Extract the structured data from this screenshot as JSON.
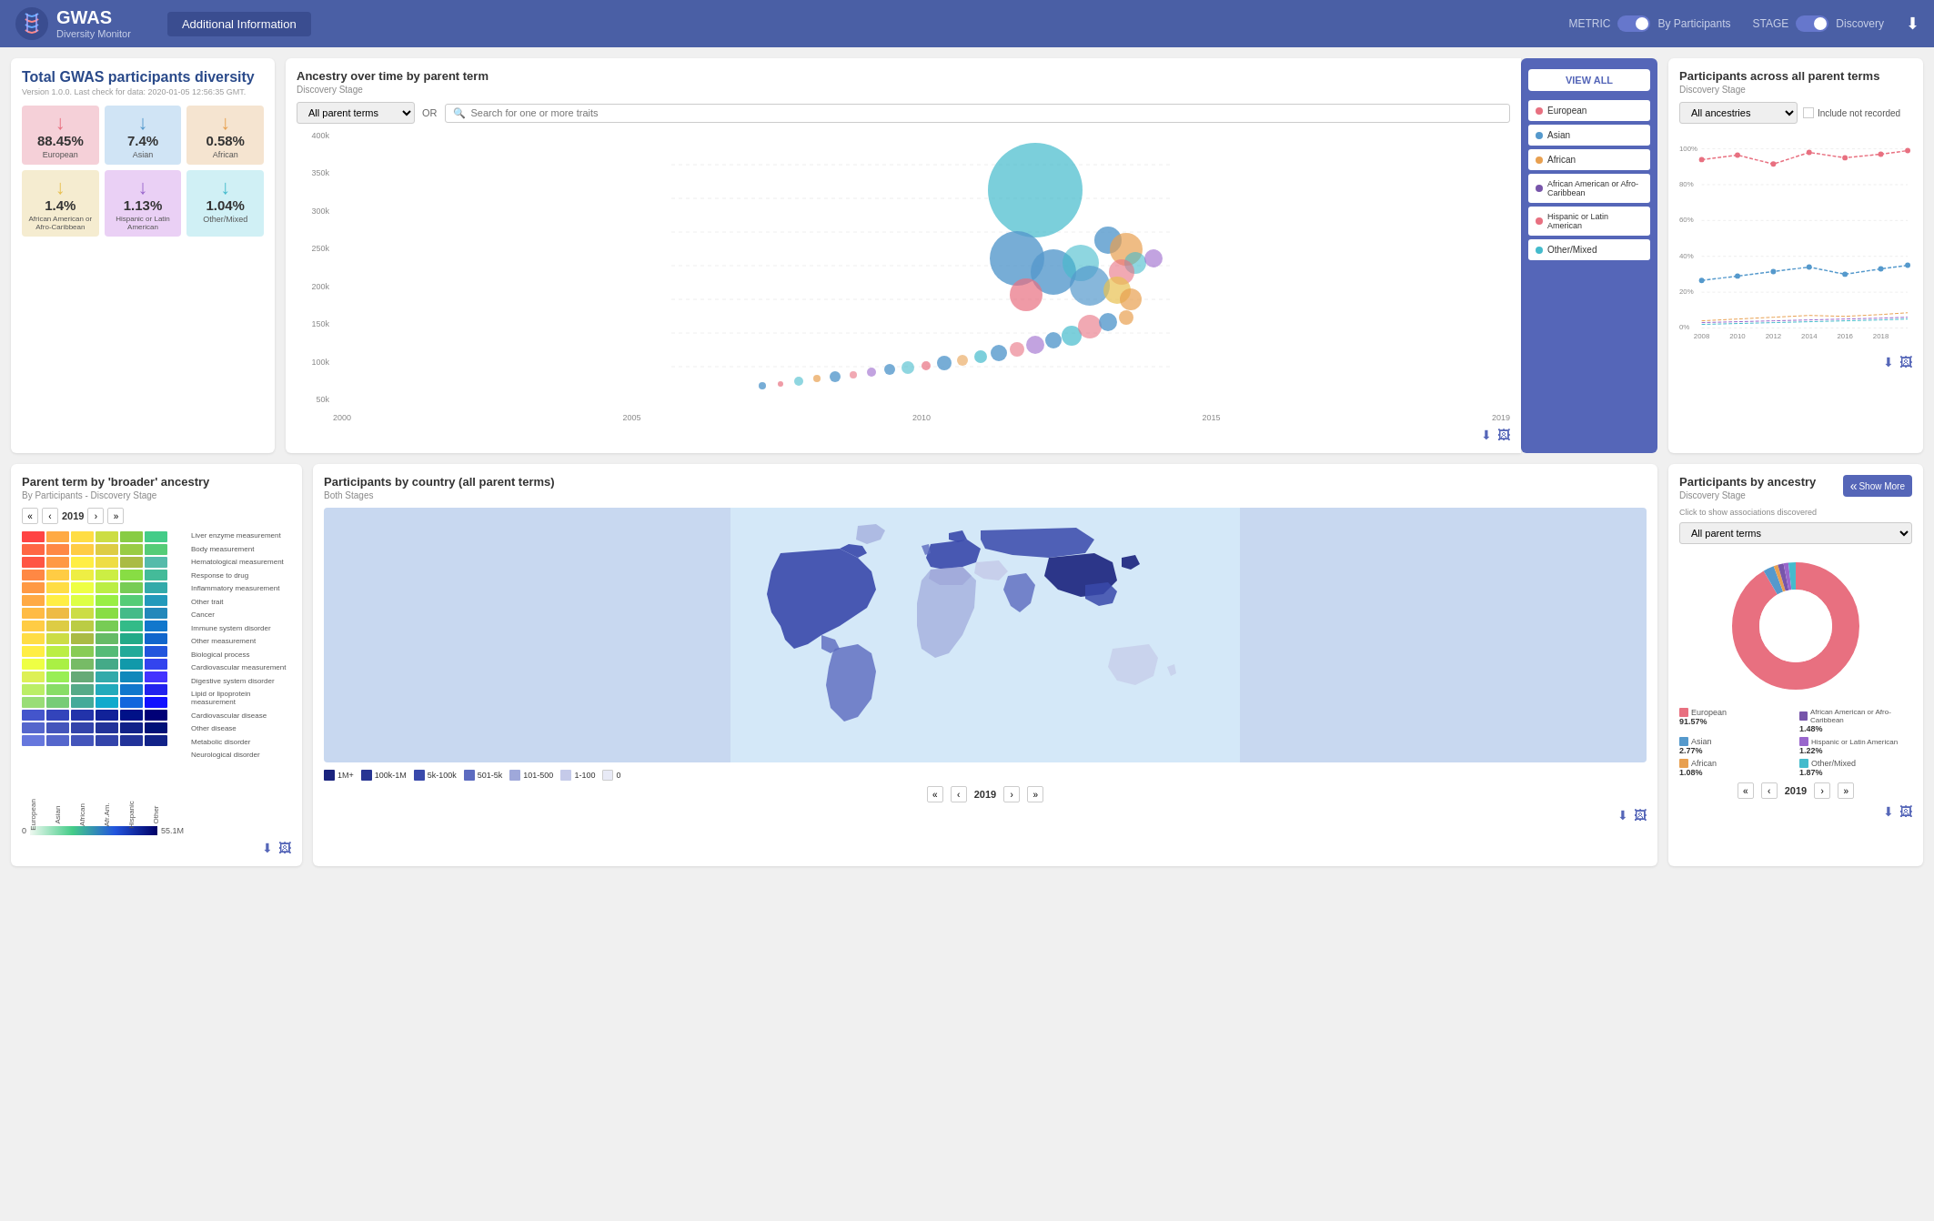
{
  "header": {
    "logo_title": "GWAS",
    "logo_subtitle": "Diversity Monitor",
    "nav_button": "Additional Information",
    "metric_label": "METRIC",
    "metric_value": "By Participants",
    "stage_label": "STAGE",
    "stage_value": "Discovery"
  },
  "stats": {
    "main_title": "Total GWAS participants diversity",
    "version": "Version 1.0.0. Last check for data: 2020-01-05 12:56:35 GMT.",
    "items": [
      {
        "pct": "88.45%",
        "label": "European",
        "color": "#e87080",
        "arrow": "↓",
        "arrow_color": "#e87080"
      },
      {
        "pct": "7.4%",
        "label": "Asian",
        "color": "#5599cc",
        "arrow": "↓",
        "arrow_color": "#5599cc"
      },
      {
        "pct": "0.58%",
        "label": "African",
        "color": "#e8a050",
        "arrow": "↓",
        "arrow_color": "#e8a050"
      },
      {
        "pct": "1.4%",
        "label": "African American or Afro-Caribbean",
        "color": "#e8c050",
        "arrow": "↓",
        "arrow_color": "#e8c050"
      },
      {
        "pct": "1.13%",
        "label": "Hispanic or Latin American",
        "color": "#9966cc",
        "arrow": "↓",
        "arrow_color": "#9966cc"
      },
      {
        "pct": "1.04%",
        "label": "Other/Mixed",
        "color": "#44bbcc",
        "arrow": "↓",
        "arrow_color": "#44bbcc"
      }
    ]
  },
  "ancestry_chart": {
    "title": "Ancestry over time by parent term",
    "subtitle": "Discovery Stage",
    "filter_placeholder": "All parent terms",
    "or_text": "OR",
    "search_placeholder": "Search for one or more traits",
    "y_labels": [
      "400k",
      "350k",
      "300k",
      "250k",
      "200k",
      "150k",
      "100k",
      "50k",
      ""
    ],
    "view_all_btn": "VIEW ALL",
    "ancestry_items": [
      {
        "name": "European",
        "color": "#e87080"
      },
      {
        "name": "Asian",
        "color": "#5599cc"
      },
      {
        "name": "African",
        "color": "#e8a050"
      },
      {
        "name": "African American or Afro-Caribbean",
        "color": "#7755aa"
      },
      {
        "name": "Hispanic or Latin American",
        "color": "#e87080"
      },
      {
        "name": "Other/Mixed",
        "color": "#44bbcc"
      }
    ]
  },
  "participants_chart": {
    "title": "Participants across all parent terms",
    "subtitle": "Discovery Stage",
    "filter": "All ancestries",
    "include_label": "Include not recorded",
    "y_labels": [
      "100%",
      "80%",
      "60%",
      "40%",
      "20%",
      "0%"
    ],
    "x_labels": [
      "2008",
      "2010",
      "2012",
      "2014",
      "2016",
      "2018"
    ]
  },
  "parent_term": {
    "title": "Parent term by 'broader' ancestry",
    "subtitle": "By Participants - Discovery Stage",
    "nav_double_left": "«",
    "nav_left": "‹",
    "year": "2019",
    "nav_right": "›",
    "nav_double_right": "»",
    "row_labels": [
      "Liver enzyme measurement",
      "Body measurement",
      "Hematological measurement",
      "Response to drug",
      "Inflammatory measurement",
      "Other trait",
      "Cancer",
      "Immune system disorder",
      "Other measurement",
      "Biological process",
      "Cardiovascular measurement",
      "Digestive system disorder",
      "Lipid or lipoprotein measurement",
      "Cardiovascular disease",
      "Other disease",
      "Metabolic disorder",
      "Neurological disorder"
    ],
    "col_labels": [
      "European",
      "Asian",
      "African",
      "African American or Afro-Caribbean",
      "Hispanic or Latin American",
      "Other/Mixed"
    ],
    "scale_min": "0",
    "scale_max": "55.1M"
  },
  "map": {
    "title": "Participants by country (all parent terms)",
    "subtitle": "Both Stages",
    "year": "2019",
    "legend": [
      {
        "label": "1M+",
        "color": "#1a237e"
      },
      {
        "label": "100k-1M",
        "color": "#283593"
      },
      {
        "label": "5k-100k",
        "color": "#3949ab"
      },
      {
        "label": "501-5k",
        "color": "#5c6bc0"
      },
      {
        "label": "101-500",
        "color": "#9fa8da"
      },
      {
        "label": "1-100",
        "color": "#c5cae9"
      },
      {
        "label": "0",
        "color": "#e8eaf6"
      }
    ]
  },
  "donut": {
    "title": "Participants by ancestry",
    "subtitle": "Discovery Stage",
    "click_label": "Click to show associations discovered",
    "filter": "All parent terms",
    "show_more": "Show More",
    "segments": [
      {
        "name": "European",
        "pct": "91.57%",
        "color": "#e87080",
        "value": 91.57
      },
      {
        "name": "Asian",
        "pct": "2.77%",
        "color": "#5599cc",
        "value": 2.77
      },
      {
        "name": "African",
        "pct": "1.08%",
        "color": "#e8a050",
        "value": 1.08
      },
      {
        "name": "African American or Afro-Caribbean",
        "pct": "1.48%",
        "color": "#7755aa",
        "value": 1.48
      },
      {
        "name": "Hispanic or Latin American",
        "pct": "1.22%",
        "color": "#9966cc",
        "value": 1.22
      },
      {
        "name": "Other/Mixed",
        "pct": "1.87%",
        "color": "#44bbcc",
        "value": 1.87
      }
    ]
  }
}
